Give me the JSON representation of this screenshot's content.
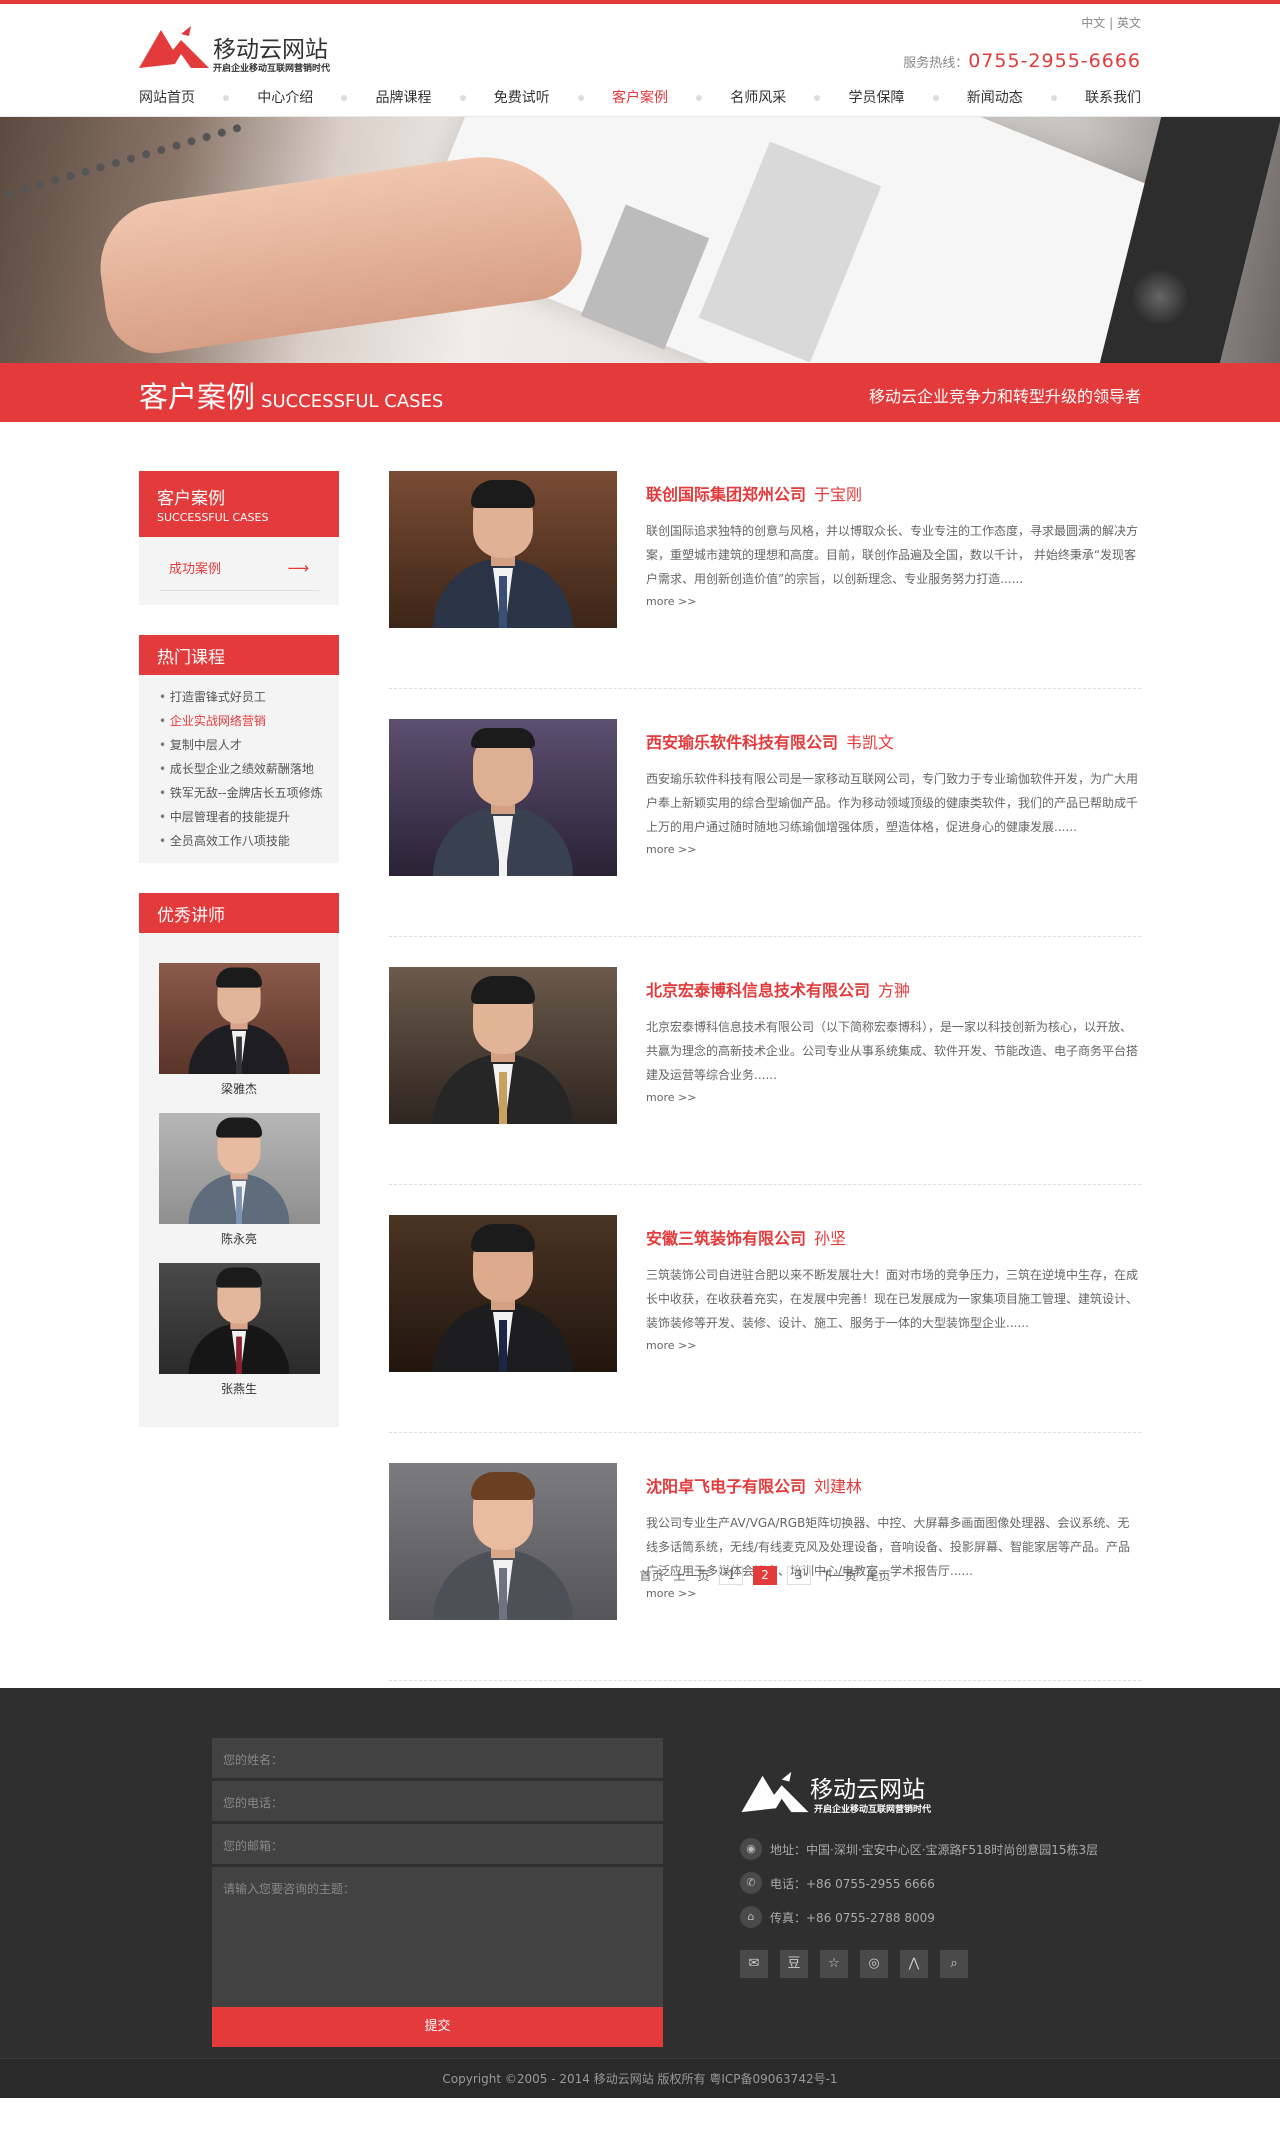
{
  "header": {
    "logo_text": "移动云网站",
    "logo_sub": "开启企业移动互联网营销时代",
    "lang_cn": "中文",
    "lang_sep": "|",
    "lang_en": "英文",
    "hotline_label": "服务热线：",
    "hotline_number": "0755-2955-6666"
  },
  "nav": {
    "items": [
      {
        "label": "网站首页"
      },
      {
        "label": "中心介绍"
      },
      {
        "label": "品牌课程"
      },
      {
        "label": "免费试听"
      },
      {
        "label": "客户案例"
      },
      {
        "label": "名师风采"
      },
      {
        "label": "学员保障"
      },
      {
        "label": "新闻动态"
      },
      {
        "label": "联系我们"
      }
    ],
    "active": "客户案例"
  },
  "titlebar": {
    "cn": "客户案例",
    "en": "SUCCESSFUL CASES",
    "slogan": "移动云企业竞争力和转型升级的领导者"
  },
  "sidebar": {
    "cases_title_cn": "客户案例",
    "cases_title_en": "SUCCESSFUL CASES",
    "cases_link": "成功案例",
    "cases_arrow": "⟶",
    "courses_title": "热门课程",
    "courses": [
      "打造雷锋式好员工",
      "企业实战网络营销",
      "复制中层人才",
      "成长型企业之绩效薪酬落地",
      "铁军无敌--金牌店长五项修炼",
      "中层管理者的技能提升",
      "全员高效工作八项技能"
    ],
    "teachers_title": "优秀讲师",
    "teachers": [
      "梁雅杰",
      "陈永亮",
      "张燕生"
    ]
  },
  "cases": [
    {
      "company": "联创国际集团郑州公司",
      "person": "于宝刚",
      "desc": "联创国际追求独特的创意与风格，并以博取众长、专业专注的工作态度，寻求最圆满的解决方案，重塑城市建筑的理想和高度。目前，联创作品遍及全国，数以千计， 并始终秉承“发现客户需求、用创新创造价值”的宗旨，以创新理念、专业服务努力打造......",
      "more": "more >>"
    },
    {
      "company": "西安瑜乐软件科技有限公司",
      "person": "韦凯文",
      "desc": "西安瑜乐软件科技有限公司是一家移动互联网公司，专门致力于专业瑜伽软件开发，为广大用户奉上新颖实用的综合型瑜伽产品。作为移动领域顶级的健康类软件，我们的产品已帮助成千上万的用户通过随时随地习练瑜伽增强体质，塑造体格，促进身心的健康发展......",
      "more": "more >>"
    },
    {
      "company": "北京宏泰博科信息技术有限公司",
      "person": "方翀",
      "desc": "北京宏泰博科信息技术有限公司（以下简称宏泰博科），是一家以科技创新为核心，以开放、共赢为理念的高新技术企业。公司专业从事系统集成、软件开发、节能改造、电子商务平台搭建及运营等综合业务......",
      "more": "more >>"
    },
    {
      "company": "安徽三筑装饰有限公司",
      "person": "孙坚",
      "desc": "三筑装饰公司自进驻合肥以来不断发展壮大！面对市场的竞争压力，三筑在逆境中生存，在成长中收获，在收获着充实，在发展中完善！现在已发展成为一家集项目施工管理、建筑设计、装饰装修等开发、装修、设计、施工、服务于一体的大型装饰型企业......",
      "more": "more >>"
    },
    {
      "company": "沈阳卓飞电子有限公司",
      "person": "刘建林",
      "desc": "我公司专业生产AV/VGA/RGB矩阵切换器、中控、大屏幕多画面图像处理器、会议系统、无线多话筒系统，无线/有线麦克风及处理设备，音响设备、投影屏幕、智能家居等产品。产品广泛应用于多媒体会议室、培训中心/电教室、学术报告厅......",
      "more": "more >>"
    }
  ],
  "pager": {
    "first": "首页",
    "prev": "上一页",
    "pages": [
      "1",
      "2",
      "3"
    ],
    "current": "2",
    "next": "下一页",
    "last": "尾页"
  },
  "footer": {
    "name_placeholder": "您的姓名：",
    "phone_placeholder": "您的电话：",
    "email_placeholder": "您的邮箱：",
    "message_placeholder": "请输入您要咨询的主题：",
    "submit": "提交",
    "logo_text": "移动云网站",
    "logo_sub": "开启企业移动互联网营销时代",
    "address": "地址：中国·深圳·宝安中心区·宝源路F518时尚创意园15栋3层",
    "phone": "电话：+86 0755-2955 6666",
    "fax": "传真：+86 0755-2788 8009",
    "social_icons": [
      "wechat-icon",
      "douban-icon",
      "star-icon",
      "weibo-icon",
      "renren-icon",
      "search-icon"
    ],
    "copyright": "Copyright ©2005 - 2014  移动云网站 版权所有      粤ICP备09063742号-1"
  },
  "colors": {
    "accent": "#e33a3b",
    "footer_bg": "#2f2f2f"
  }
}
